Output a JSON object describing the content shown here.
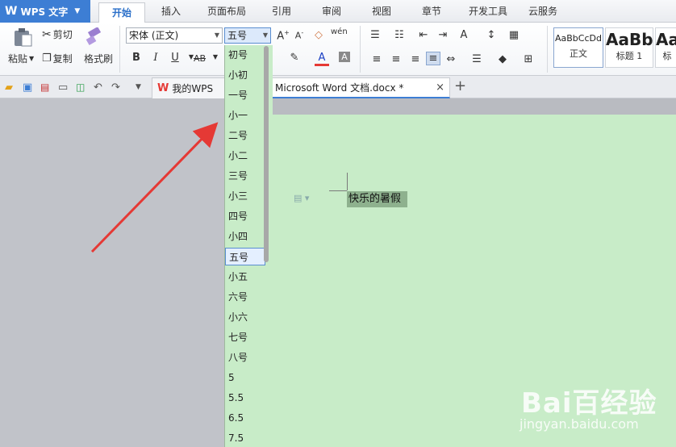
{
  "app": {
    "title": "WPS 文字",
    "logo": "W"
  },
  "menu_tabs": [
    "开始",
    "插入",
    "页面布局",
    "引用",
    "审阅",
    "视图",
    "章节",
    "开发工具",
    "云服务"
  ],
  "active_tab": "开始",
  "ribbon": {
    "paste": "粘贴",
    "cut": "剪切",
    "copy": "复制",
    "format_painter": "格式刷",
    "font_name": "宋体 (正文)",
    "font_size": "五号",
    "bold": "B",
    "italic": "I",
    "underline": "U",
    "ab": "AB",
    "styles": [
      {
        "sample": "AaBbCcDd",
        "label": "正文"
      },
      {
        "sample": "AaBb",
        "label": "标题 1"
      },
      {
        "sample": "Aa",
        "label": "标"
      }
    ]
  },
  "quick_bar": {
    "wps_tab": "我的WPS",
    "doc_tab": "Microsoft Word 文档.docx *",
    "close": "×",
    "new_tab": "+"
  },
  "document": {
    "selected_text": "快乐的暑假"
  },
  "font_size_options": [
    "初号",
    "小初",
    "一号",
    "小一",
    "二号",
    "小二",
    "三号",
    "小三",
    "四号",
    "小四",
    "五号",
    "小五",
    "六号",
    "小六",
    "七号",
    "八号",
    "5",
    "5.5",
    "6.5",
    "7.5"
  ],
  "selected_font_size": "五号",
  "watermark": {
    "brand": "Bai百经验",
    "url": "jingyan.baidu.com"
  },
  "colors": {
    "accent": "#3d7ed4",
    "page": "#c8ecc8",
    "arrow": "#e53935"
  }
}
